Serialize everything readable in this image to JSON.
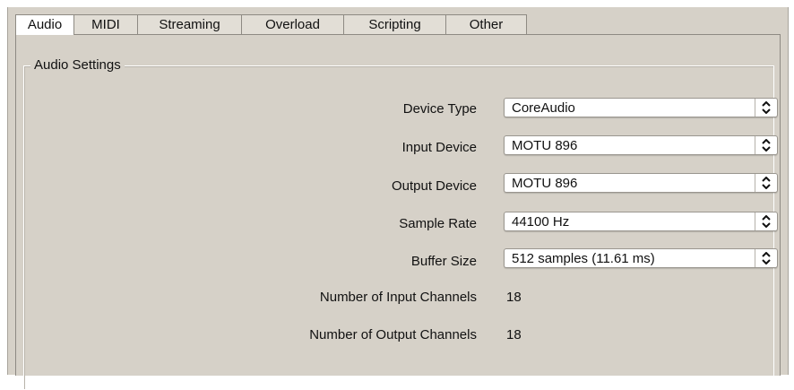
{
  "tabs": [
    {
      "label": "Audio",
      "active": true
    },
    {
      "label": "MIDI",
      "active": false
    },
    {
      "label": "Streaming",
      "active": false
    },
    {
      "label": "Overload",
      "active": false
    },
    {
      "label": "Scripting",
      "active": false
    },
    {
      "label": "Other",
      "active": false
    }
  ],
  "group": {
    "title": "Audio Settings"
  },
  "settings": {
    "device_type": {
      "label": "Device Type",
      "value": "CoreAudio"
    },
    "input_device": {
      "label": "Input Device",
      "value": "MOTU 896"
    },
    "output_device": {
      "label": "Output Device",
      "value": "MOTU 896"
    },
    "sample_rate": {
      "label": "Sample Rate",
      "value": "44100 Hz"
    },
    "buffer_size": {
      "label": "Buffer Size",
      "value": "512 samples (11.61 ms)"
    }
  },
  "info": {
    "input_channels": {
      "label": "Number of Input Channels",
      "value": "18"
    },
    "output_channels": {
      "label": "Number of Output Channels",
      "value": "18"
    }
  },
  "icons": {
    "select_arrows": "up-down-chevron-icon"
  },
  "colors": {
    "background": "#d6d1c8",
    "active_tab": "#ffffff"
  }
}
